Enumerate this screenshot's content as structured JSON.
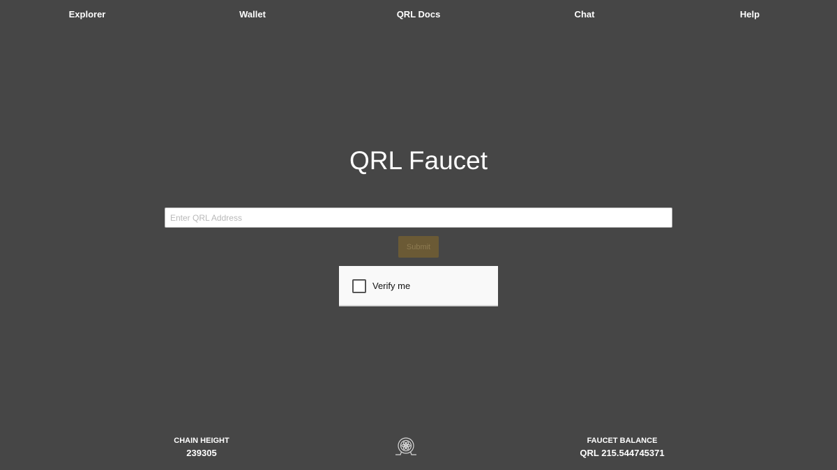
{
  "nav": {
    "items": [
      {
        "label": "Explorer"
      },
      {
        "label": "Wallet"
      },
      {
        "label": "QRL Docs"
      },
      {
        "label": "Chat"
      },
      {
        "label": "Help"
      }
    ]
  },
  "main": {
    "title": "QRL Faucet",
    "address_placeholder": "Enter QRL Address",
    "address_value": "",
    "submit_label": "Submit",
    "captcha_label": "Verify me"
  },
  "footer": {
    "chain_height_label": "CHAIN HEIGHT",
    "chain_height_value": "239305",
    "faucet_balance_label": "FAUCET BALANCE",
    "faucet_balance_value": "QRL 215.544745371",
    "logo_icon": "qrl-logo-icon"
  },
  "colors": {
    "background": "#464646",
    "submit_bg": "#6b5a35",
    "text": "#ffffff"
  }
}
